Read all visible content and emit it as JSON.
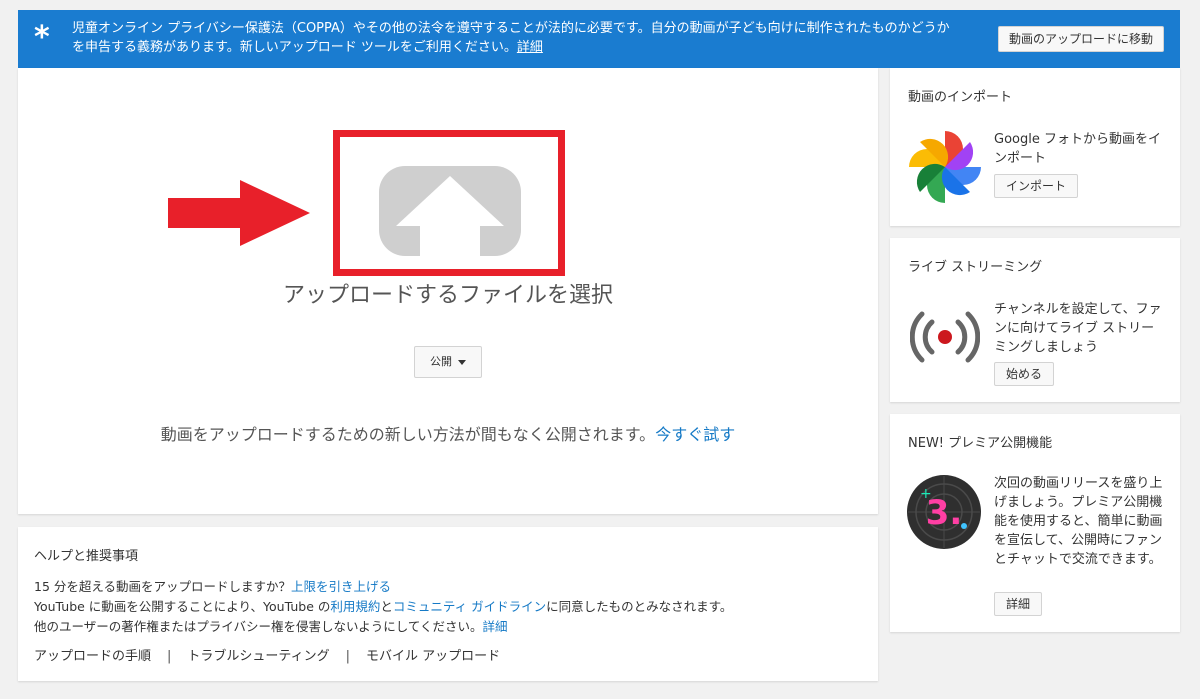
{
  "banner": {
    "star": "*",
    "message": "児童オンライン プライバシー保護法（COPPA）やその他の法令を遵守することが法的に必要です。自分の動画が子ども向けに制作されたものかどうかを申告する義務があります。新しいアップロード ツールをご利用ください。",
    "more_link": "詳細",
    "button": "動画のアップロードに移動",
    "color": "#1a7cd0"
  },
  "upload": {
    "title": "アップロードするファイルを選択",
    "privacy": "公開",
    "new_method_text": "動画をアップロードするための新しい方法が間もなく公開されます。",
    "try_link": "今すぐ試す",
    "highlight_color": "#e8202a",
    "arrow_color": "#e8202a"
  },
  "help": {
    "title": "ヘルプと推奨事項",
    "line1_text": "15 分を超える動画をアップロードしますか？",
    "line1_link": "上限を引き上げる",
    "line2_a": "YouTube に動画を公開することにより、YouTube の",
    "line2_link1": "利用規約",
    "line2_b": "と",
    "line2_link2": "コミュニティ ガイドライン",
    "line2_c": "に同意したものとみなされます。",
    "line3_text": "他のユーザーの著作権またはプライバシー権を侵害しないようにしてください。",
    "line3_link": "詳細",
    "links": [
      "アップロードの手順",
      "トラブルシューティング",
      "モバイル アップロード"
    ],
    "separator": "|"
  },
  "sidebar": {
    "import": {
      "title": "動画のインポート",
      "text": "Google フォトから動画をインポート",
      "button": "インポート",
      "icon": "google-photos-icon"
    },
    "live": {
      "title": "ライブ ストリーミング",
      "text": "チャンネルを設定して、ファンに向けてライブ ストリーミングしましょう",
      "button": "始める",
      "icon": "live-broadcast-icon"
    },
    "premiere": {
      "title": "NEW! プレミア公開機能",
      "text": "次回の動画リリースを盛り上げましょう。プレミア公開機能を使用すると、簡単に動画を宣伝して、公開時にファンとチャットで交流できます。",
      "button": "詳細",
      "icon_digit": "3."
    }
  }
}
